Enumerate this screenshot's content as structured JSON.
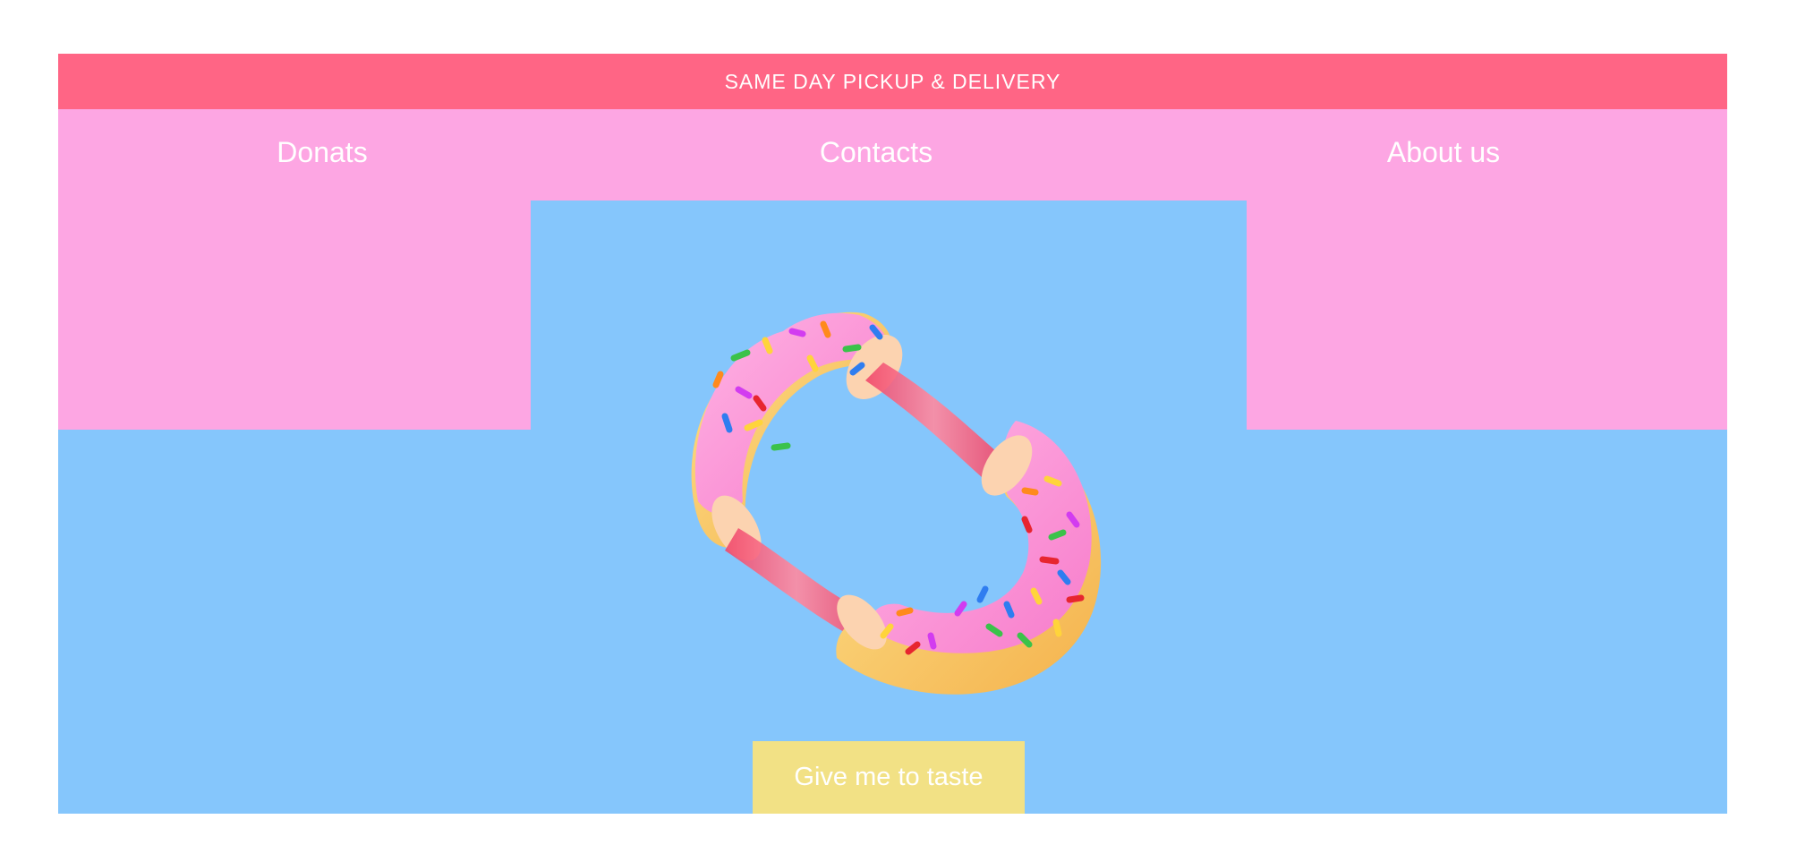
{
  "banner": {
    "text": "SAME DAY PICKUP & DELIVERY"
  },
  "nav": {
    "items": [
      {
        "label": "Donats"
      },
      {
        "label": "Contacts"
      },
      {
        "label": "About us"
      }
    ]
  },
  "hero": {
    "image_icon": "donut-illustration",
    "cta_label": "Give me to taste"
  },
  "colors": {
    "banner": "#ff6585",
    "nav_background": "#fda6e3",
    "hero_background": "#85c6fc",
    "cta_background": "#f2e185",
    "text": "#ffffff"
  }
}
